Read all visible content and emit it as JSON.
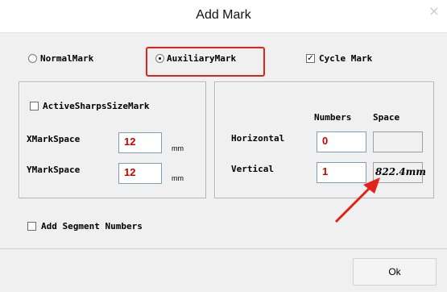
{
  "window": {
    "title": "Add Mark",
    "close": "×"
  },
  "mark_type": {
    "options": [
      {
        "label": "NormalMark",
        "selected": false
      },
      {
        "label": "AuxiliaryMark",
        "selected": true
      }
    ],
    "highlight_color": "#e2231a"
  },
  "cycle_mark": {
    "label": "Cycle Mark",
    "checked": true,
    "mark": "✓"
  },
  "left_panel": {
    "active_sharps": {
      "label": "ActiveSharpsSizeMark",
      "checked": false
    },
    "x_space": {
      "label": "XMarkSpace",
      "value": "12",
      "unit": "mm"
    },
    "y_space": {
      "label": "YMarkSpace",
      "value": "12",
      "unit": "mm"
    }
  },
  "right_panel": {
    "col_numbers": "Numbers",
    "col_space": "Space",
    "horizontal": {
      "label": "Horizontal",
      "numbers": "0",
      "space": ""
    },
    "vertical": {
      "label": "Vertical",
      "numbers": "1",
      "space": "822.4mm"
    },
    "arrow_color": "#e2231a"
  },
  "segment_numbers": {
    "label": "Add Segment Numbers",
    "checked": false
  },
  "ok_button": {
    "label": "Ok"
  }
}
